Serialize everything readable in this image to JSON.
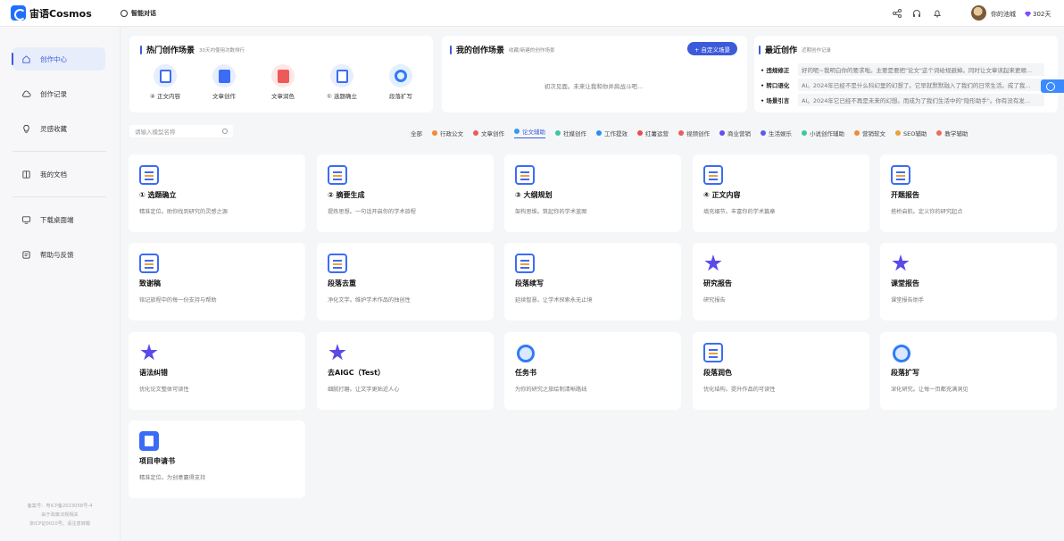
{
  "app": {
    "name": "宙语Cosmos",
    "chat_label": "智能对话"
  },
  "user": {
    "name": "你的池城",
    "days": "302天"
  },
  "sidebar": {
    "items": [
      {
        "label": "创作中心",
        "icon": "home-icon"
      },
      {
        "label": "创作记录",
        "icon": "cloud-icon"
      },
      {
        "label": "灵感收藏",
        "icon": "bulb-icon"
      },
      {
        "label": "我的文档",
        "icon": "book-icon"
      },
      {
        "label": "下载桌面端",
        "icon": "monitor-icon"
      },
      {
        "label": "帮助与反馈",
        "icon": "help-icon"
      }
    ],
    "icp_lines": [
      "备案号：粤ICP备2023058号-4",
      "由于政策法规相关",
      "京ICP证0010号。请注意转载"
    ]
  },
  "hot": {
    "title": "热门创作场景",
    "subtitle": "30天内使用次数排行",
    "items": [
      {
        "label": "④ 正文内容",
        "color": "#3b6cf6",
        "bg": "#e7eefe"
      },
      {
        "label": "文章创作",
        "color": "#3b6cf6",
        "bg": "#e7eefe"
      },
      {
        "label": "文章润色",
        "color": "#ee5a5a",
        "bg": "#fde8e8"
      },
      {
        "label": "① 选题确立",
        "color": "#3b6cf6",
        "bg": "#e7eefe"
      },
      {
        "label": "段落扩写",
        "color": "#2f7cf6",
        "bg": "#e4efff"
      }
    ]
  },
  "mine": {
    "title": "我的创作场景",
    "subtitle": "收藏/新建的创作场景",
    "button": "+ 自定义场景",
    "empty": "初次见面。未来让我和你并肩战斗吧..."
  },
  "recent": {
    "title": "最近创作",
    "subtitle": "近期创作记录",
    "rows": [
      {
        "k": "• 违规修正",
        "v": "好的呢~我明白你的要求啦。主要是要把\"论文\"这个词给规避掉。同时让文章读起来更顺..."
      },
      {
        "k": "• 转口语化",
        "v": "AI。2024年已经不是什么科幻里的幻想了。它早就默默融入了我们的日常生活。成了我..."
      },
      {
        "k": "• 场景引言",
        "v": "AI。2024年它已经不再是未来的幻想。而成为了我们生活中的\"隐形助手\"。你有没有发..."
      }
    ]
  },
  "search": {
    "placeholder": "请输入模型名称"
  },
  "filters": [
    {
      "label": "全部",
      "color": ""
    },
    {
      "label": "行政公文",
      "color": "#f08a3a"
    },
    {
      "label": "文章创作",
      "color": "#ee5a5a"
    },
    {
      "label": "论文辅助",
      "color": "#2f9cf0"
    },
    {
      "label": "社媒创作",
      "color": "#38c9a0"
    },
    {
      "label": "工作提效",
      "color": "#2f8cf0"
    },
    {
      "label": "红薯运营",
      "color": "#ee4a4a"
    },
    {
      "label": "视频创作",
      "color": "#f05a5a"
    },
    {
      "label": "商业营销",
      "color": "#6a4af0"
    },
    {
      "label": "生活娱乐",
      "color": "#5a5af0"
    },
    {
      "label": "小说创作辅助",
      "color": "#38c9a0"
    },
    {
      "label": "营销软文",
      "color": "#f08a3a"
    },
    {
      "label": "SEO辅助",
      "color": "#f0a03a"
    },
    {
      "label": "教学辅助",
      "color": "#f06a5a"
    }
  ],
  "tiles": [
    {
      "t": "① 选题确立",
      "d": "精准定位。助你找到研究的灵感之源",
      "icon": "doc"
    },
    {
      "t": "② 摘要生成",
      "d": "提炼思想。一句话开启你的学术旅程",
      "icon": "doc"
    },
    {
      "t": "③ 大纲规划",
      "d": "架构思维。筑起你的学术蓝图",
      "icon": "doc"
    },
    {
      "t": "④ 正文内容",
      "d": "填充细节。丰富你的学术篇章",
      "icon": "doc"
    },
    {
      "t": "开题报告",
      "d": "搭桥启航。定义你的研究起点",
      "icon": "doc"
    },
    {
      "t": "致谢稿",
      "d": "铭记旅程中的每一份支持与帮助",
      "icon": "doc"
    },
    {
      "t": "段落去重",
      "d": "净化文字。维护学术作品的独创性",
      "icon": "doc"
    },
    {
      "t": "段落续写",
      "d": "延续智慧。让学术探索永无止境",
      "icon": "doc"
    },
    {
      "t": "研究报告",
      "d": "研究报告",
      "icon": "star"
    },
    {
      "t": "课堂报告",
      "d": "课堂报告助手",
      "icon": "star"
    },
    {
      "t": "语法纠错",
      "d": "优化论文整体可读性",
      "icon": "star"
    },
    {
      "t": "去AIGC（Test）",
      "d": "细腻打磨。让文字更贴近人心",
      "icon": "star"
    },
    {
      "t": "任务书",
      "d": "为你的研究之旅绘制清晰路线",
      "icon": "ring"
    },
    {
      "t": "段落润色",
      "d": "优化结构。提升作品的可读性",
      "icon": "doc"
    },
    {
      "t": "段落扩写",
      "d": "深化研究。让每一页都充满洞见",
      "icon": "ring"
    },
    {
      "t": "项目申请书",
      "d": "精准定位。为创意赢得支持",
      "icon": "blue"
    }
  ]
}
